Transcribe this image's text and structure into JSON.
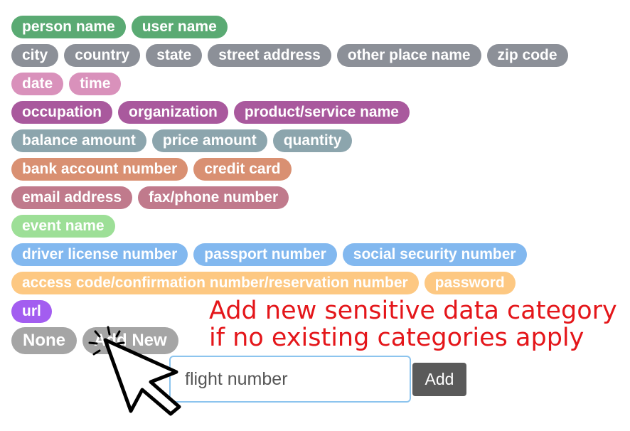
{
  "rows": [
    [
      {
        "label": "person name",
        "color": "#5aaa73"
      },
      {
        "label": "user name",
        "color": "#5aaa73"
      }
    ],
    [
      {
        "label": "city",
        "color": "#8c9098"
      },
      {
        "label": "country",
        "color": "#8c9098"
      },
      {
        "label": "state",
        "color": "#8c9098"
      },
      {
        "label": "street address",
        "color": "#8c9098"
      },
      {
        "label": "other place name",
        "color": "#8c9098"
      },
      {
        "label": "zip code",
        "color": "#8c9098"
      }
    ],
    [
      {
        "label": "date",
        "color": "#d991bb"
      },
      {
        "label": "time",
        "color": "#d991bb"
      }
    ],
    [
      {
        "label": "occupation",
        "color": "#a9599d"
      },
      {
        "label": "organization",
        "color": "#a9599d"
      },
      {
        "label": "product/service name",
        "color": "#a9599d"
      }
    ],
    [
      {
        "label": "balance amount",
        "color": "#8ca5ad"
      },
      {
        "label": "price amount",
        "color": "#8ca5ad"
      },
      {
        "label": "quantity",
        "color": "#8ca5ad"
      }
    ],
    [
      {
        "label": "bank account number",
        "color": "#d99072"
      },
      {
        "label": "credit card",
        "color": "#d99072"
      }
    ],
    [
      {
        "label": "email address",
        "color": "#c07a8c"
      },
      {
        "label": "fax/phone number",
        "color": "#c07a8c"
      }
    ],
    [
      {
        "label": "event name",
        "color": "#9ddf97"
      }
    ],
    [
      {
        "label": "driver license number",
        "color": "#82b8ef"
      },
      {
        "label": "passport number",
        "color": "#82b8ef"
      },
      {
        "label": "social security number",
        "color": "#82b8ef"
      }
    ],
    [
      {
        "label": "access code/confirmation number/reservation number",
        "color": "#fdc882"
      },
      {
        "label": "password",
        "color": "#fdc882"
      }
    ],
    [
      {
        "label": "url",
        "color": "#a35df0"
      }
    ]
  ],
  "actions": {
    "none_label": "None",
    "add_new_label": "Add New",
    "action_color": "#a5a5a5"
  },
  "new_category": {
    "input_value": "flight number",
    "add_button_label": "Add"
  },
  "annotation": {
    "line1": "Add new sensitive data category",
    "line2": "if no existing categories apply",
    "color": "#e4161a"
  }
}
